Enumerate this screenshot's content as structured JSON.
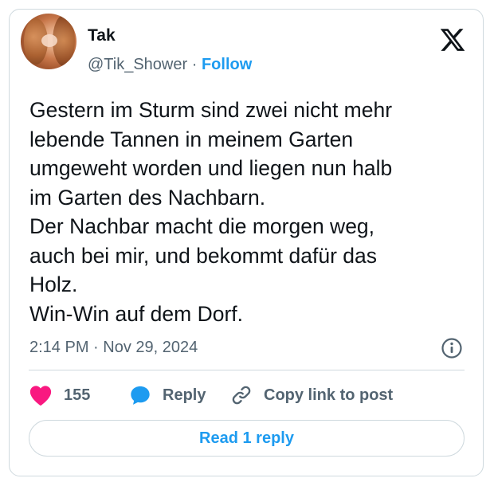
{
  "author": {
    "name": "Tak",
    "handle": "@Tik_Shower",
    "separator": "·",
    "follow_label": "Follow"
  },
  "tweet": {
    "text": "Gestern im Sturm sind zwei nicht mehr\nlebende Tannen in meinem Garten\numgeweht worden und liegen nun halb\nim Garten des Nachbarn.\nDer Nachbar macht die morgen weg,\nauch bei mir, und bekommt dafür das\nHolz.\nWin-Win auf dem Dorf.",
    "timestamp": "2:14 PM · Nov 29, 2024"
  },
  "actions": {
    "like_count": "155",
    "reply_label": "Reply",
    "copy_link_label": "Copy link to post"
  },
  "read_replies_label": "Read 1 reply",
  "icons": {
    "platform": "x-logo-icon",
    "info": "info-icon",
    "like": "heart-icon",
    "reply": "speech-bubble-icon",
    "copy": "link-icon"
  },
  "colors": {
    "accent": "#1d9bf0",
    "like": "#f91880",
    "text_primary": "#0f1419",
    "text_secondary": "#536471",
    "border": "#cfd9de"
  }
}
